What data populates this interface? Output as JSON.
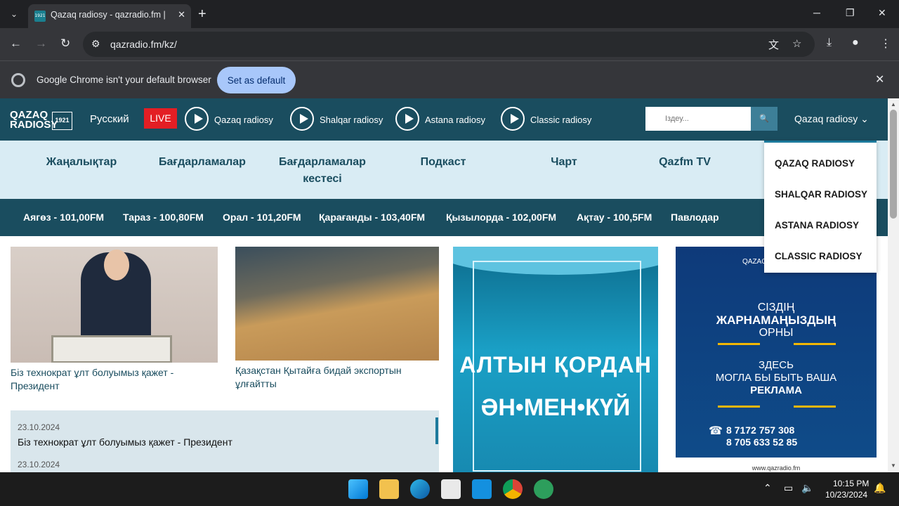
{
  "browser": {
    "tab_title": "Qazaq radiosy - qazradio.fm | K",
    "favicon_text": "1921",
    "url": "qazradio.fm/kz/",
    "infobar_text": "Google Chrome isn't your default browser",
    "infobar_button": "Set as default"
  },
  "header": {
    "logo_line1": "QAZAQ",
    "logo_line2": "RADIOSY",
    "logo_year": "1921",
    "lang_link": "Русский",
    "live_label": "LIVE",
    "radios": [
      "Qazaq radiosy",
      "Shalqar radiosy",
      "Astana radiosy",
      "Classic radiosy"
    ],
    "search_placeholder": "Іздеу...",
    "station_select": "Qazaq radiosy"
  },
  "menu": {
    "items": [
      "Жаңалықтар",
      "Бағдарламалар",
      "Бағдарламалар кестесі",
      "Подкаст",
      "Чарт",
      "Qazfm TV"
    ]
  },
  "cities": [
    "Аягөз - 101,00FM",
    "Тараз - 100,80FM",
    "Орал - 101,20FM",
    "Қарағанды - 103,40FM",
    "Қызылорда - 102,00FM",
    "Ақтау - 100,5FM",
    "Павлодар"
  ],
  "news": {
    "card1_caption": "Біз технократ ұлт болуымыз қажет - Президент",
    "card2_caption": "Қазақстан Қытайға бидай экспортын ұлғайтты",
    "list": [
      {
        "date": "23.10.2024",
        "title": "Біз технократ ұлт болуымыз қажет - Президент"
      },
      {
        "date": "23.10.2024",
        "title": ""
      }
    ]
  },
  "banner1": {
    "line1": "АЛТЫН ҚОРДАН",
    "line2": "ӘН•МЕН•КҮЙ"
  },
  "banner2": {
    "brand": "QAZAQ",
    "line1": "СІЗДІҢ",
    "line2": "ЖАРНАМАҢЫЗДЫҢ",
    "line3": "ОРНЫ",
    "line4": "ЗДЕСЬ",
    "line5": "МОГЛА БЫ БЫТЬ ВАША",
    "line6": "РЕКЛАМА",
    "phone1": "8 7172 757 308",
    "phone2": "8 705 633 52 85",
    "site": "www.qazradio.fm"
  },
  "dropdown": {
    "items": [
      "QAZAQ RADIOSY",
      "SHALQAR RADIOSY",
      "ASTANA RADIOSY",
      "CLASSIC RADIOSY"
    ]
  },
  "taskbar": {
    "time": "10:15 PM",
    "date": "10/23/2024"
  }
}
